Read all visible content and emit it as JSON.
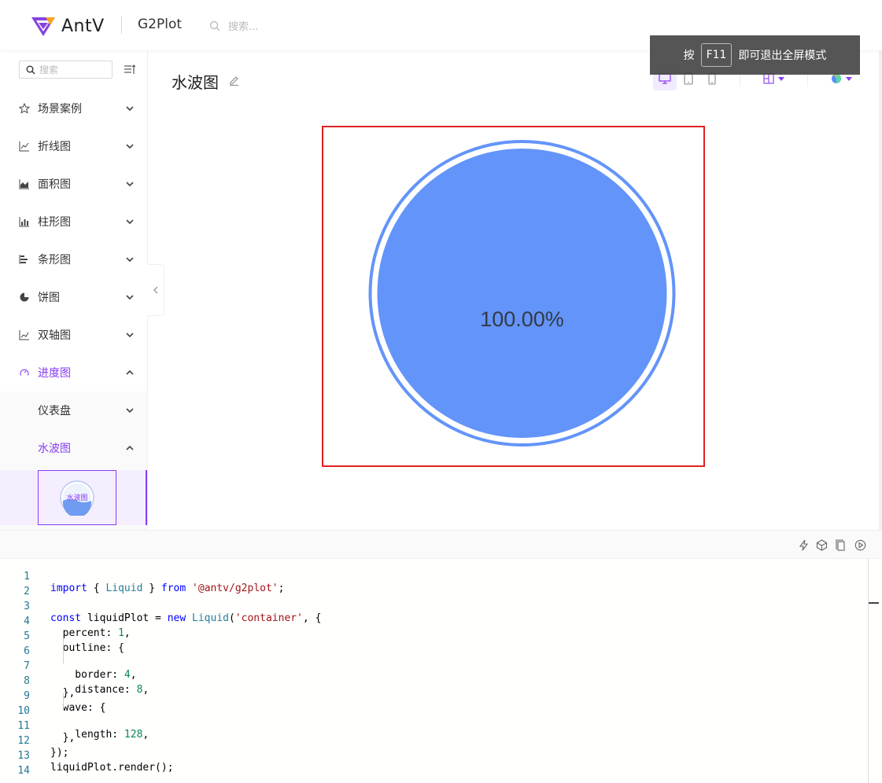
{
  "header": {
    "brand": "AntV",
    "product": "G2Plot",
    "search_placeholder": "搜索..."
  },
  "toast": {
    "before": "按",
    "key": "F11",
    "after": "即可退出全屏模式"
  },
  "sidebar": {
    "search_placeholder": "搜索",
    "items": [
      {
        "label": "场景案例",
        "icon": "star-icon"
      },
      {
        "label": "折线图",
        "icon": "line-chart-icon"
      },
      {
        "label": "面积图",
        "icon": "area-chart-icon"
      },
      {
        "label": "柱形图",
        "icon": "column-chart-icon"
      },
      {
        "label": "条形图",
        "icon": "bar-chart-icon"
      },
      {
        "label": "饼图",
        "icon": "pie-chart-icon"
      },
      {
        "label": "双轴图",
        "icon": "dual-axes-icon"
      },
      {
        "label": "进度图",
        "icon": "gauge-icon"
      }
    ],
    "subitems": [
      {
        "label": "仪表盘"
      },
      {
        "label": "水波图"
      }
    ],
    "thumb_label": "水波图"
  },
  "main": {
    "title": "水波图"
  },
  "chart_data": {
    "type": "liquid",
    "percent": 1,
    "label": "100.00%",
    "outline": {
      "border": 4,
      "distance": 8
    },
    "wave": {
      "length": 128
    },
    "color": "#6394f9",
    "frame_color": "#e02020"
  },
  "colors": {
    "accent": "#873bf4",
    "liquid": "#6394f9"
  },
  "code": {
    "lines": [
      "import { Liquid } from '@antv/g2plot';",
      "",
      "const liquidPlot = new Liquid('container', {",
      "  percent: 1,",
      "  outline: {",
      "    border: 4,",
      "    distance: 8,",
      "  },",
      "  wave: {",
      "    length: 128,",
      "  },",
      "});",
      "liquidPlot.render();",
      ""
    ]
  }
}
